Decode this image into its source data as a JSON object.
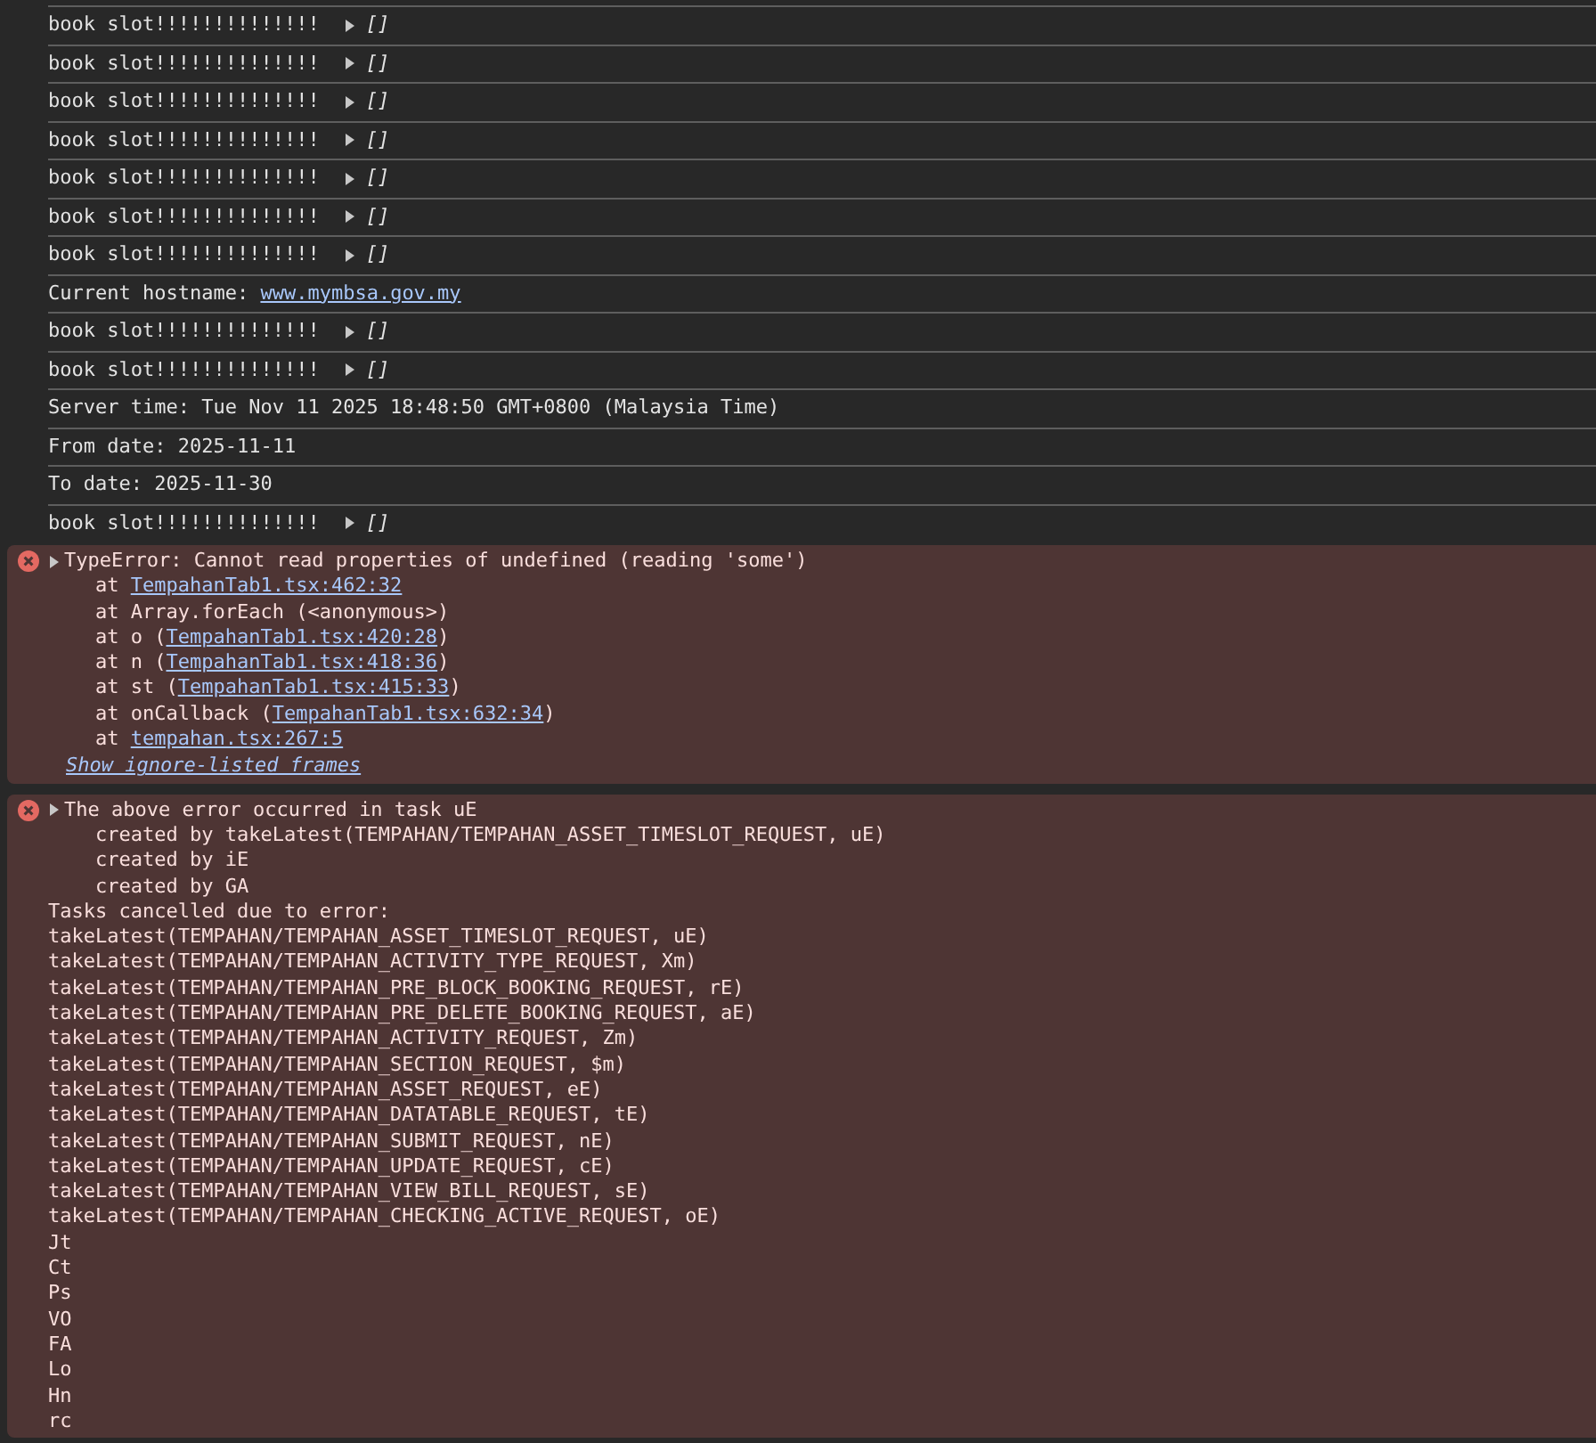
{
  "console": {
    "entries": [
      {
        "kind": "log",
        "text": "book slot!!!!!!!!!!!!!!",
        "value": "[]",
        "expanded": false
      },
      {
        "kind": "log",
        "text": "book slot!!!!!!!!!!!!!!",
        "value": "[]",
        "expanded": false
      },
      {
        "kind": "log",
        "text": "book slot!!!!!!!!!!!!!!",
        "value": "[]",
        "expanded": false
      },
      {
        "kind": "log",
        "text": "book slot!!!!!!!!!!!!!!",
        "value": "[]",
        "expanded": false
      },
      {
        "kind": "log",
        "text": "book slot!!!!!!!!!!!!!!",
        "value": "[]",
        "expanded": false
      },
      {
        "kind": "log",
        "text": "book slot!!!!!!!!!!!!!!",
        "value": "[]",
        "expanded": false
      },
      {
        "kind": "log",
        "text": "book slot!!!!!!!!!!!!!!",
        "value": "[]",
        "expanded": false
      },
      {
        "kind": "log",
        "text": "Current hostname: ",
        "link": "www.mymbsa.gov.my"
      },
      {
        "kind": "log",
        "text": "book slot!!!!!!!!!!!!!!",
        "value": "[]",
        "expanded": false
      },
      {
        "kind": "log",
        "text": "book slot!!!!!!!!!!!!!!",
        "value": "[]",
        "expanded": false
      },
      {
        "kind": "log",
        "text": "Server time: Tue Nov 11 2025 18:48:50 GMT+0800 (Malaysia Time)"
      },
      {
        "kind": "log",
        "text": "From date: 2025-11-11"
      },
      {
        "kind": "log",
        "text": "To date: 2025-11-30"
      },
      {
        "kind": "log",
        "text": "book slot!!!!!!!!!!!!!!",
        "value": "[]",
        "expanded": false
      },
      {
        "kind": "error",
        "expanded": false,
        "message": "TypeError: Cannot read properties of undefined (reading 'some')",
        "lines": [
          {
            "text": "    at ",
            "link": "TempahanTab1.tsx:462:32"
          },
          {
            "text": "    at Array.forEach (<anonymous>)"
          },
          {
            "text": "    at o (",
            "link": "TempahanTab1.tsx:420:28",
            "after": ")"
          },
          {
            "text": "    at n (",
            "link": "TempahanTab1.tsx:418:36",
            "after": ")"
          },
          {
            "text": "    at st (",
            "link": "TempahanTab1.tsx:415:33",
            "after": ")"
          },
          {
            "text": "    at onCallback (",
            "link": "TempahanTab1.tsx:632:34",
            "after": ")"
          },
          {
            "text": "    at ",
            "link": "tempahan.tsx:267:5"
          }
        ],
        "more_link": "Show ignore-listed frames"
      },
      {
        "kind": "error",
        "expanded": false,
        "message": "The above error occurred in task uE",
        "lines": [
          {
            "text": "    created by takeLatest(TEMPAHAN/TEMPAHAN_ASSET_TIMESLOT_REQUEST, uE)"
          },
          {
            "text": "    created by iE"
          },
          {
            "text": "    created by GA"
          },
          {
            "text": "Tasks cancelled due to error:"
          },
          {
            "text": "takeLatest(TEMPAHAN/TEMPAHAN_ASSET_TIMESLOT_REQUEST, uE)"
          },
          {
            "text": "takeLatest(TEMPAHAN/TEMPAHAN_ACTIVITY_TYPE_REQUEST, Xm)"
          },
          {
            "text": "takeLatest(TEMPAHAN/TEMPAHAN_PRE_BLOCK_BOOKING_REQUEST, rE)"
          },
          {
            "text": "takeLatest(TEMPAHAN/TEMPAHAN_PRE_DELETE_BOOKING_REQUEST, aE)"
          },
          {
            "text": "takeLatest(TEMPAHAN/TEMPAHAN_ACTIVITY_REQUEST, Zm)"
          },
          {
            "text": "takeLatest(TEMPAHAN/TEMPAHAN_SECTION_REQUEST, $m)"
          },
          {
            "text": "takeLatest(TEMPAHAN/TEMPAHAN_ASSET_REQUEST, eE)"
          },
          {
            "text": "takeLatest(TEMPAHAN/TEMPAHAN_DATATABLE_REQUEST, tE)"
          },
          {
            "text": "takeLatest(TEMPAHAN/TEMPAHAN_SUBMIT_REQUEST, nE)"
          },
          {
            "text": "takeLatest(TEMPAHAN/TEMPAHAN_UPDATE_REQUEST, cE)"
          },
          {
            "text": "takeLatest(TEMPAHAN/TEMPAHAN_VIEW_BILL_REQUEST, sE)"
          },
          {
            "text": "takeLatest(TEMPAHAN/TEMPAHAN_CHECKING_ACTIVE_REQUEST, oE)"
          },
          {
            "text": "Jt"
          },
          {
            "text": "Ct"
          },
          {
            "text": "Ps"
          },
          {
            "text": "VO"
          },
          {
            "text": "FA"
          },
          {
            "text": "Lo"
          },
          {
            "text": "Hn"
          },
          {
            "text": "rc"
          }
        ]
      }
    ]
  }
}
